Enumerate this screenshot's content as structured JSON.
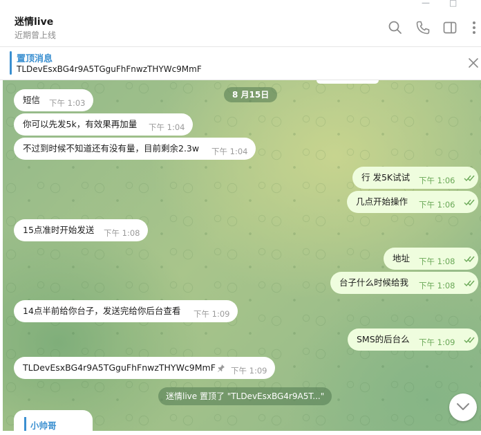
{
  "header": {
    "title": "迷情live",
    "status": "近期曾上线",
    "icons": [
      "search-icon",
      "phone-icon",
      "sidebar-toggle-icon",
      "more-vertical-icon"
    ]
  },
  "pinned": {
    "label": "置顶消息",
    "text": "TLDevEsxBG4r9A5TGguFhFnwzTHYWc9MmF"
  },
  "chat": {
    "date_chip": "8 月15日",
    "messages": [
      {
        "dir": "in",
        "text": "短信",
        "time": "下午 1:03"
      },
      {
        "dir": "in",
        "text": "你可以先发5k，有效果再加量",
        "time": "下午 1:04"
      },
      {
        "dir": "in",
        "text": "不过到时候不知道还有没有量，目前剩余2.3w",
        "time": "下午 1:04"
      },
      {
        "dir": "out",
        "text": "行 发5K试试",
        "time": "下午 1:06"
      },
      {
        "dir": "out",
        "text": "几点开始操作",
        "time": "下午 1:06"
      },
      {
        "dir": "in",
        "text": "15点准时开始发送",
        "time": "下午 1:08"
      },
      {
        "dir": "out",
        "text": "地址",
        "time": "下午 1:08"
      },
      {
        "dir": "out",
        "text": "台子什么时候给我",
        "time": "下午 1:08"
      },
      {
        "dir": "in",
        "text": "14点半前给你台子，发送完给你后台查看",
        "time": "下午 1:09"
      },
      {
        "dir": "out",
        "text": "SMS的后台么",
        "time": "下午 1:09"
      },
      {
        "dir": "in",
        "text": "TLDevEsxBG4r9A5TGguFhFnwzTHYWc9MmF",
        "time": "下午 1:09",
        "pinned": true
      }
    ],
    "service_message": "迷情live 置顶了 \"TLDevEsxBG4r9A5T...\"",
    "partial_sender": "小帅哥"
  },
  "colors": {
    "accent": "#3a8fd0",
    "outgoing_bubble": "#effdde",
    "incoming_bubble": "#ffffff",
    "read_ticks": "#6aa857"
  }
}
